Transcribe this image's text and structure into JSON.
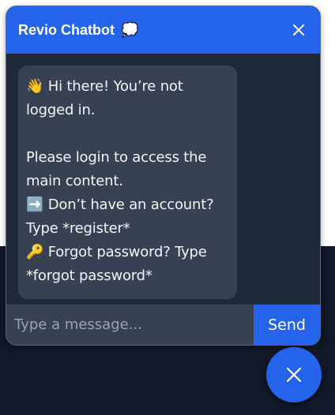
{
  "header": {
    "title": "Revio Chatbot",
    "title_emoji": "💭",
    "close_icon": "close-icon"
  },
  "messages": [
    {
      "lines": [
        "👋 Hi there! You’re not",
        "logged in.",
        "",
        "Please login to access the",
        "main content.",
        "➡️ Don’t have an account?",
        "Type *register*",
        "🔑 Forgot password? Type",
        "*forgot password*"
      ]
    }
  ],
  "composer": {
    "placeholder": "Type a message...",
    "send_label": "Send"
  },
  "launcher": {
    "icon": "close-icon"
  },
  "colors": {
    "accent": "#2563eb",
    "panel": "#1f2937",
    "bubble": "#374151",
    "page_dark": "#111827"
  }
}
